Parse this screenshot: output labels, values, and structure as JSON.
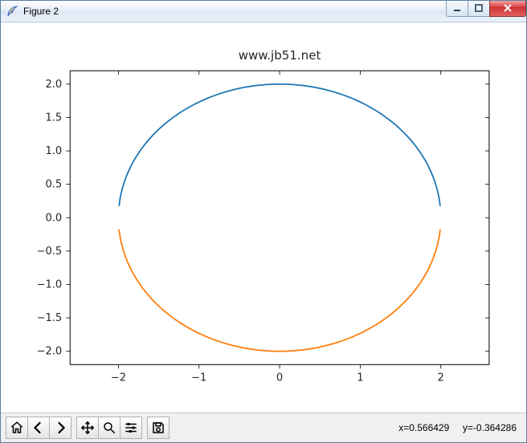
{
  "window": {
    "title": "Figure 2"
  },
  "toolbar": {
    "coord_text": "x=0.566429     y=-0.364286"
  },
  "chart_data": {
    "type": "line",
    "title": "www.jb51.net",
    "xlabel": "",
    "ylabel": "",
    "xlim": [
      -2.6,
      2.6
    ],
    "ylim": [
      -2.2,
      2.2
    ],
    "xticks": [
      -2,
      -1,
      0,
      1,
      2
    ],
    "yticks": [
      -2.0,
      -1.5,
      -1.0,
      -0.5,
      0.0,
      0.5,
      1.0,
      1.5,
      2.0
    ],
    "xtick_labels": [
      "−2",
      "−1",
      "0",
      "1",
      "2"
    ],
    "ytick_labels": [
      "−2.0",
      "−1.5",
      "−1.0",
      "−0.5",
      "0.0",
      "0.5",
      "1.0",
      "1.5",
      "2.0"
    ],
    "series": [
      {
        "name": "upper_arc",
        "color": "#1f77b4",
        "type": "parametric_arc",
        "center": [
          0,
          0
        ],
        "radius": 2,
        "theta_start_deg": 175,
        "theta_end_deg": 5,
        "direction": "ccw_over_top"
      },
      {
        "name": "lower_arc",
        "color": "#ff7f0e",
        "type": "parametric_arc",
        "center": [
          0,
          0
        ],
        "radius": 2,
        "theta_start_deg": 185,
        "theta_end_deg": 355,
        "direction": "cw_under_bottom"
      }
    ]
  }
}
